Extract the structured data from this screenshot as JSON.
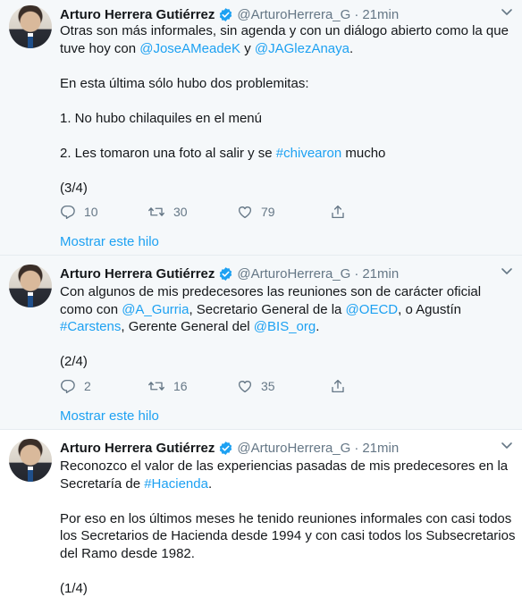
{
  "author": {
    "name": "Arturo Herrera Gutiérrez",
    "handle": "@ArturoHerrera_G"
  },
  "tweets": [
    {
      "time": "21min",
      "p1_a": "Otras son más informales, sin agenda y con un diálogo abierto como la que tuve hoy con ",
      "m1": "@JoseAMeadeK",
      "p1_b": " y ",
      "m2": "@JAGlezAnaya",
      "p1_c": ".",
      "p2": "En esta última sólo hubo dos problemitas:",
      "p3": "1. No hubo chilaquiles en el menú",
      "p4_a": "2. Les tomaron una foto al salir y se ",
      "h1": "#chivearon",
      "p4_b": " mucho",
      "counter": "(3/4)",
      "replies": "10",
      "retweets": "30",
      "likes": "79",
      "show_thread": "Mostrar este hilo"
    },
    {
      "time": "21min",
      "p1_a": "Con algunos de mis predecesores las reuniones son de carácter oficial como con ",
      "m1": "@A_Gurria",
      "p1_b": ", Secretario General de la ",
      "m2": "@OECD",
      "p1_c": ", o Agustín ",
      "h1": "#Carstens",
      "p1_d": ", Gerente General del ",
      "m3": "@BIS_org",
      "p1_e": ".",
      "counter": "(2/4)",
      "replies": "2",
      "retweets": "16",
      "likes": "35",
      "show_thread": "Mostrar este hilo"
    },
    {
      "time": "21min",
      "p1_a": "Reconozco el valor de las experiencias pasadas de mis predecesores en la Secretaría de ",
      "h1": "#Hacienda",
      "p1_b": ".",
      "p2": "Por eso en los últimos meses he tenido reuniones informales con casi todos los Secretarios de Hacienda desde 1994 y con casi todos los Subsecretarios del Ramo desde 1982.",
      "counter": "(1/4)"
    }
  ],
  "separator": "·",
  "colors": {
    "link": "#1da1f2",
    "text": "#14171a",
    "muted": "#657786",
    "thread_bg": "#f5f8fa",
    "border": "#e6ecf0"
  },
  "icons": [
    "verified-badge-icon",
    "chevron-down-icon",
    "reply-icon",
    "retweet-icon",
    "like-icon",
    "share-icon"
  ]
}
